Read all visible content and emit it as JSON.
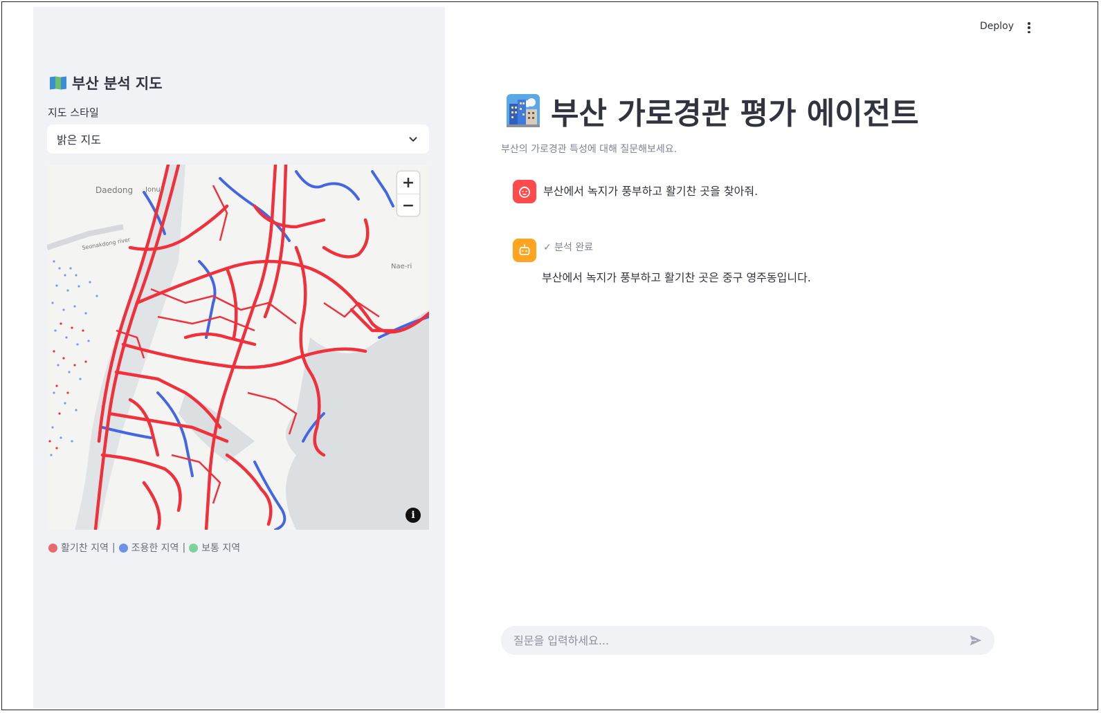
{
  "header": {
    "deploy_label": "Deploy"
  },
  "sidebar": {
    "title": "부산 분석 지도",
    "style_label": "지도 스타일",
    "style_selected": "밝은 지도",
    "map": {
      "labels": [
        "Daedong",
        "Jonul",
        "Nae-ri",
        "Seonakdong river"
      ],
      "legend": [
        {
          "label": "활기찬 지역",
          "color": "#e8696c"
        },
        {
          "label": "조용한 지역",
          "color": "#6f8fe8"
        },
        {
          "label": "보통 지역",
          "color": "#7fd39a"
        }
      ],
      "legend_sep": "|",
      "zoom_in": "+",
      "zoom_out": "−",
      "info": "i"
    }
  },
  "main": {
    "title": "부산 가로경관 평가 에이전트",
    "caption": "부산의 가로경관 특성에 대해 질문해보세요.",
    "messages": [
      {
        "role": "user",
        "text": "부산에서 녹지가 풍부하고 활기찬 곳을 찾아줘.",
        "avatar_color": "#ff4b4b"
      },
      {
        "role": "assistant",
        "status": "✓ 분석 완료",
        "text": "부산에서 녹지가 풍부하고 활기찬 곳은 중구 영주동입니다.",
        "avatar_color": "#ffa421"
      }
    ],
    "chat_placeholder": "질문을 입력하세요..."
  },
  "colors": {
    "road_active": "#f0303a",
    "road_quiet": "#4466e0",
    "sidebar_bg": "#f0f2f6"
  },
  "icons": [
    "world-map-icon",
    "chevron-down-icon",
    "kebab-menu-icon",
    "city-icon",
    "user-avatar-icon",
    "bot-avatar-icon",
    "send-icon",
    "info-icon"
  ]
}
